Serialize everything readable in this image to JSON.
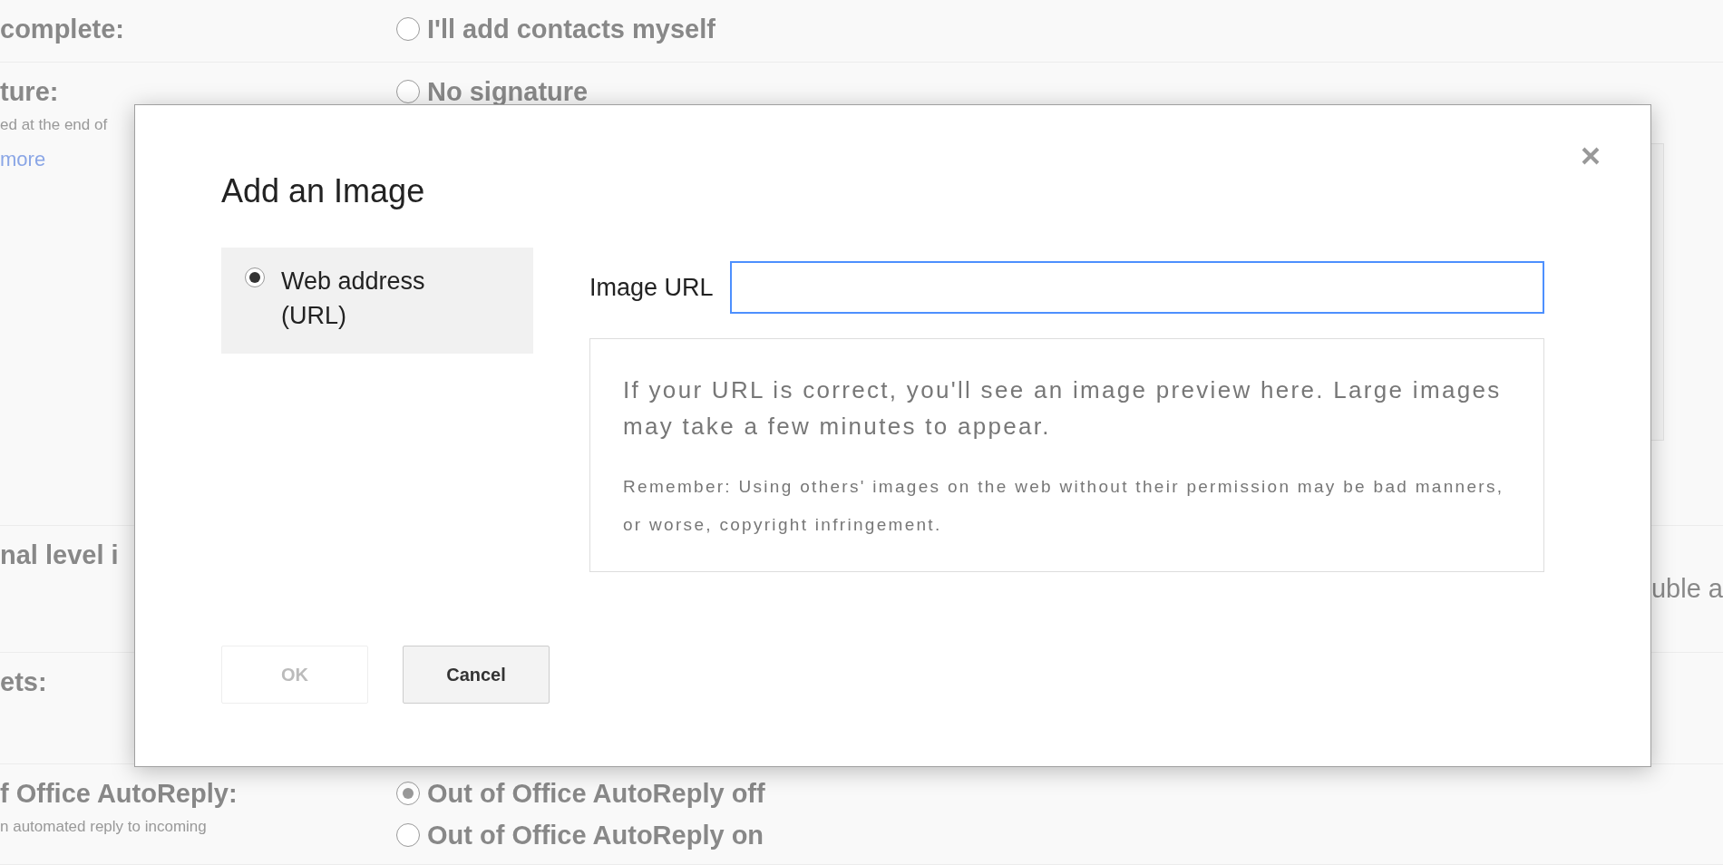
{
  "settings": {
    "rows": [
      {
        "label": "complete:",
        "options": [
          {
            "label": "I'll add contacts myself",
            "selected": false
          }
        ]
      },
      {
        "label": "ture:",
        "description": "ed at the end of",
        "link": "more",
        "options": [
          {
            "label": "No signature",
            "selected": false
          }
        ]
      },
      {
        "label": "nal level i",
        "trailing": "uble a"
      },
      {
        "label": "ets:"
      },
      {
        "label": "f Office AutoReply:",
        "description": "n automated reply to incoming",
        "options": [
          {
            "label": "Out of Office AutoReply off",
            "selected": true
          },
          {
            "label": "Out of Office AutoReply on",
            "selected": false
          }
        ]
      }
    ]
  },
  "dialog": {
    "title": "Add an Image",
    "sources": [
      {
        "label": "Web address (URL)",
        "selected": true
      }
    ],
    "field_label": "Image URL",
    "field_focused": true,
    "preview_text": "If your URL is correct, you'll see an image preview here. Large images may take a few minutes to appear.",
    "preview_note": "Remember: Using others' images on the web without their permission may be bad manners, or worse, copyright infringement.",
    "buttons": [
      {
        "label": "OK",
        "disabled": true
      },
      {
        "label": "Cancel",
        "disabled": false
      }
    ]
  }
}
